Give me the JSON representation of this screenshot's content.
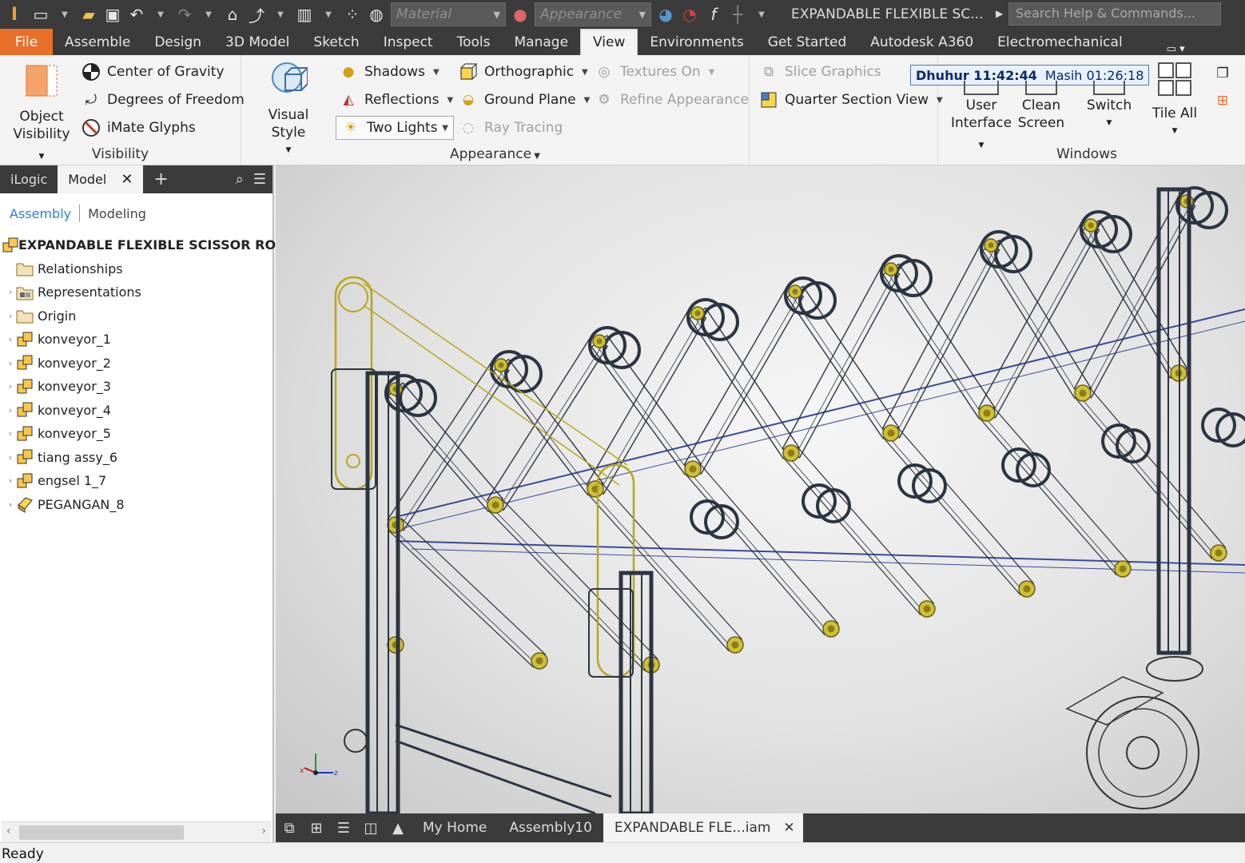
{
  "qat": {
    "material_placeholder": "Material",
    "appearance_placeholder": "Appearance",
    "document_title": "EXPANDABLE FLEXIBLE SC...",
    "search_placeholder": "Search Help & Commands..."
  },
  "tabs": [
    "File",
    "Assemble",
    "Design",
    "3D Model",
    "Sketch",
    "Inspect",
    "Tools",
    "Manage",
    "View",
    "Environments",
    "Get Started",
    "Autodesk A360",
    "Electromechanical"
  ],
  "active_tab": "View",
  "ribbon": {
    "visibility": {
      "title": "Visibility",
      "object_visibility": [
        "Object",
        "Visibility"
      ],
      "items": [
        "Center of Gravity",
        "Degrees of Freedom",
        "iMate Glyphs"
      ]
    },
    "appearance": {
      "title": "Appearance",
      "visual_style": "Visual Style",
      "shadows": "Shadows",
      "reflections": "Reflections",
      "two_lights": "Two Lights",
      "orthographic": "Orthographic",
      "ground_plane": "Ground Plane",
      "ray_tracing": "Ray Tracing",
      "textures_on": "Textures On",
      "refine_appearance": "Refine Appearance"
    },
    "slice": {
      "slice_graphics": "Slice Graphics",
      "quarter_section": "Quarter Section View"
    },
    "clock": {
      "label1": "Dhuhur 11:42:44",
      "label2": "Masih 01:26:18"
    },
    "windows": {
      "title": "Windows",
      "user_interface": [
        "User",
        "Interface"
      ],
      "clean_screen": [
        "Clean",
        "Screen"
      ],
      "switch": "Switch",
      "tile_all": "Tile All"
    }
  },
  "browser": {
    "tabs": [
      "iLogic",
      "Model"
    ],
    "sub_tabs": [
      "Assembly",
      "Modeling"
    ],
    "tree": [
      {
        "label": "EXPANDABLE FLEXIBLE SCISSOR ROLLI",
        "icon": "assembly-icon",
        "root": true
      },
      {
        "label": "Relationships",
        "icon": "folder-icon"
      },
      {
        "label": "Representations",
        "icon": "representations-icon"
      },
      {
        "label": "Origin",
        "icon": "folder-icon"
      },
      {
        "label": "konveyor_1",
        "icon": "assembly-icon"
      },
      {
        "label": "konveyor_2",
        "icon": "assembly-icon"
      },
      {
        "label": "konveyor_3",
        "icon": "assembly-icon"
      },
      {
        "label": "konveyor_4",
        "icon": "assembly-icon"
      },
      {
        "label": "konveyor_5",
        "icon": "assembly-icon"
      },
      {
        "label": "tiang assy_6",
        "icon": "assembly-icon"
      },
      {
        "label": "engsel 1_7",
        "icon": "assembly-icon"
      },
      {
        "label": "PEGANGAN_8",
        "icon": "part-icon"
      }
    ]
  },
  "doc_tabs": [
    "My Home",
    "Assembly10",
    "EXPANDABLE FLE...iam"
  ],
  "status": "Ready",
  "colors": {
    "accent": "#e9702a",
    "dark": "#3b3b3b",
    "highlight": "#b8a61c",
    "wire": "#2c3442"
  }
}
